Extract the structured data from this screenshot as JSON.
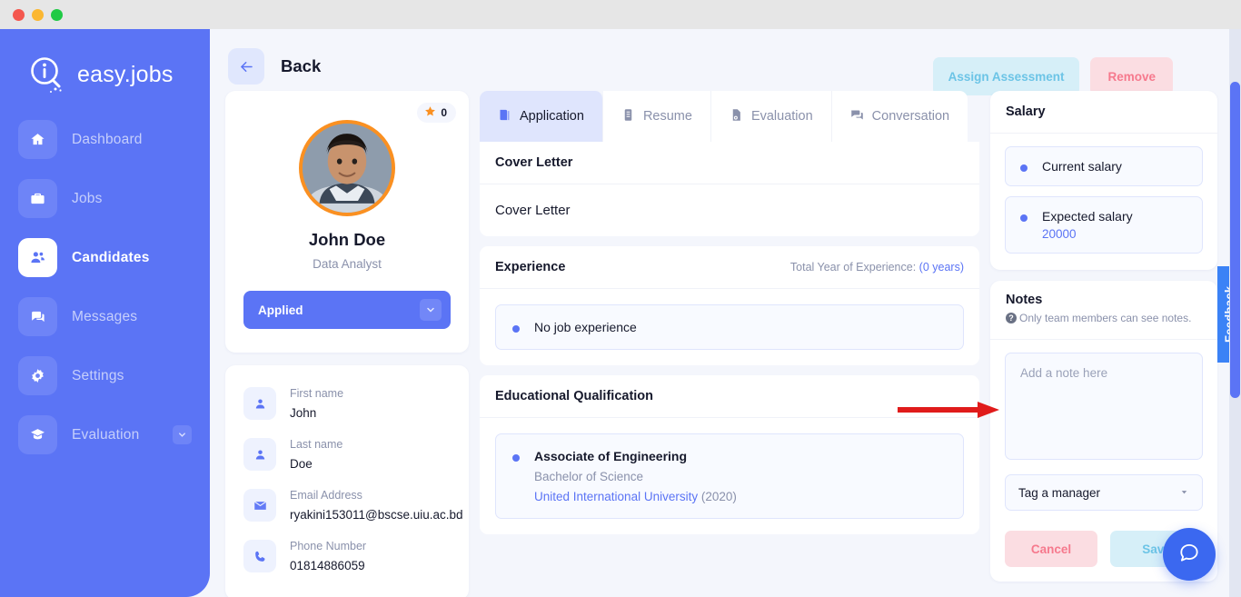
{
  "window": {
    "traffic_lights": [
      "close",
      "minimize",
      "maximize"
    ]
  },
  "sidebar": {
    "brand": "easy.jobs",
    "items": [
      {
        "label": "Dashboard",
        "icon": "home-icon",
        "active": false,
        "caret": false
      },
      {
        "label": "Jobs",
        "icon": "briefcase-icon",
        "active": false,
        "caret": false
      },
      {
        "label": "Candidates",
        "icon": "user-group-icon",
        "active": true,
        "caret": false
      },
      {
        "label": "Messages",
        "icon": "chat-icon",
        "active": false,
        "caret": false
      },
      {
        "label": "Settings",
        "icon": "gear-icon",
        "active": false,
        "caret": false
      },
      {
        "label": "Evaluation",
        "icon": "graduation-icon",
        "active": false,
        "caret": true
      }
    ]
  },
  "topbar": {
    "back_label": "Back",
    "assign_label": "Assign Assessment",
    "remove_label": "Remove"
  },
  "profile": {
    "rating": "0",
    "name": "John Doe",
    "role": "Data Analyst",
    "status": "Applied",
    "fields": [
      {
        "label": "First name",
        "value": "John",
        "icon": "person-icon"
      },
      {
        "label": "Last name",
        "value": "Doe",
        "icon": "person-icon"
      },
      {
        "label": "Email Address",
        "value": "ryakini153011@bscse.uiu.ac.bd",
        "icon": "envelope-icon"
      },
      {
        "label": "Phone Number",
        "value": "01814886059",
        "icon": "phone-icon"
      }
    ]
  },
  "tabs": [
    {
      "label": "Application",
      "icon": "book-icon",
      "active": true
    },
    {
      "label": "Resume",
      "icon": "document-icon",
      "active": false
    },
    {
      "label": "Evaluation",
      "icon": "file-icon",
      "active": false
    },
    {
      "label": "Conversation",
      "icon": "comments-icon",
      "active": false
    }
  ],
  "main": {
    "cover_letter": {
      "heading": "Cover Letter",
      "body": "Cover Letter"
    },
    "experience": {
      "heading": "Experience",
      "meta_label": "Total Year of Experience:",
      "meta_value": "(0 years)",
      "item": "No job experience"
    },
    "education": {
      "heading": "Educational Qualification",
      "degree": "Associate of Engineering",
      "level": "Bachelor of Science",
      "institute": "United International University",
      "year": "(2020)"
    }
  },
  "salary": {
    "heading": "Salary",
    "items": [
      {
        "label": "Current salary",
        "value": ""
      },
      {
        "label": "Expected salary",
        "value": "20000"
      }
    ]
  },
  "notes": {
    "heading": "Notes",
    "hint": "Only team members can see notes.",
    "placeholder": "Add a note here",
    "tag_placeholder": "Tag a manager",
    "cancel_label": "Cancel",
    "save_label": "Save"
  },
  "feedback": {
    "label": "Feedback"
  },
  "chat": {
    "icon": "chat-bubble-icon"
  },
  "colors": {
    "brand_blue": "#5b74f5",
    "page_bg": "#f4f6fc",
    "accent_orange": "#fa9021",
    "danger_pink": "#f6798d",
    "info_cyan": "#6cc4e6",
    "annotation_red": "#e01b1b"
  }
}
